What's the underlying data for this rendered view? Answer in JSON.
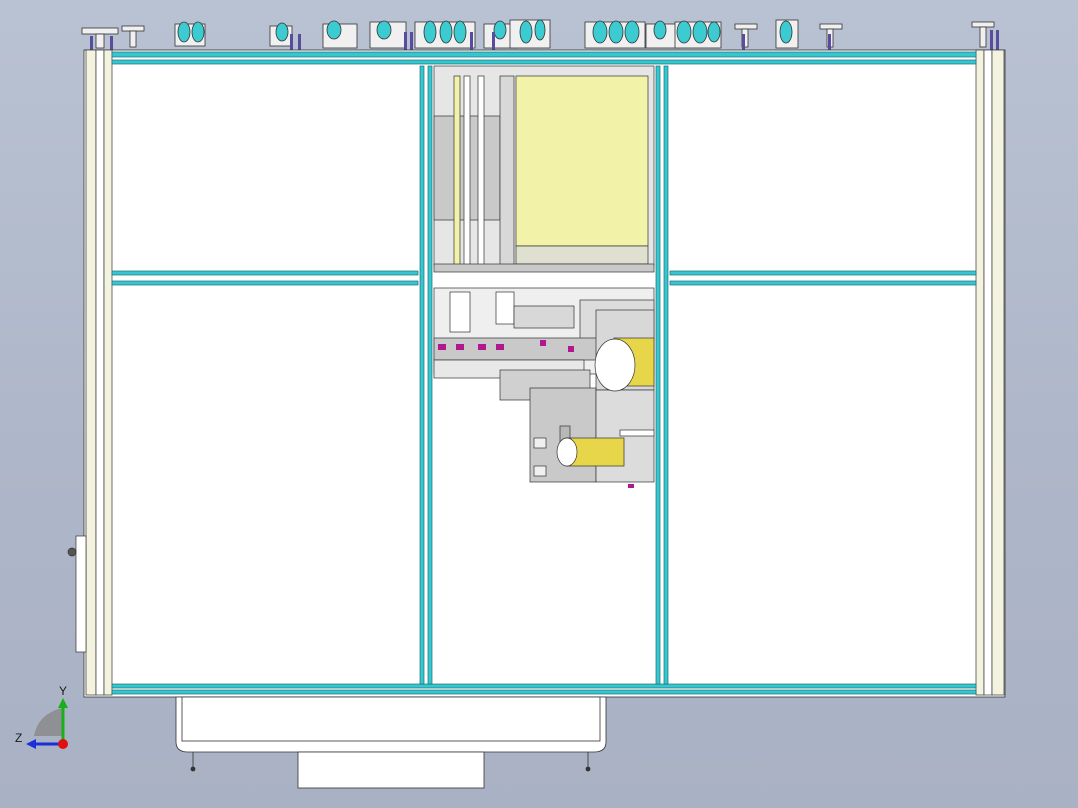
{
  "viewport": {
    "background": "#b3bccd",
    "frame_color": "#35c6cf",
    "panel_color": "#ffffff",
    "post_color": "#f4f3df",
    "fill_yellow": "#f2f2a8",
    "metal_grey": "#c9c9c9",
    "accent_magenta": "#b01890"
  },
  "triad": {
    "y_label": "Y",
    "z_label": "Z",
    "y_color": "#18b018",
    "z_color": "#1a2fd8",
    "x_color": "#e01010"
  }
}
